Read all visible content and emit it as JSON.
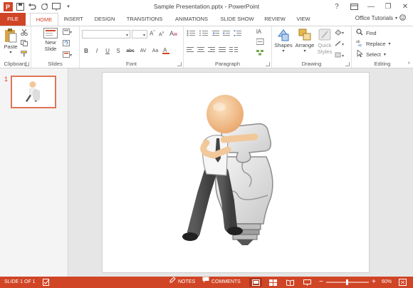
{
  "window": {
    "title": "Sample Presentation.pptx - PowerPoint",
    "help": "?",
    "minimize": "—",
    "restore": "❐",
    "close": "✕"
  },
  "tabs": [
    "FILE",
    "HOME",
    "INSERT",
    "DESIGN",
    "TRANSITIONS",
    "ANIMATIONS",
    "SLIDE SHOW",
    "REVIEW",
    "VIEW"
  ],
  "account": "Office Tutorials",
  "ribbon": {
    "clipboard": {
      "label": "Clipboard",
      "paste": "Paste"
    },
    "slides": {
      "label": "Slides",
      "new_slide": "New\nSlide"
    },
    "font": {
      "label": "Font",
      "format_buttons": [
        "B",
        "I",
        "U",
        "S",
        "abc",
        "AV",
        "Aa"
      ]
    },
    "paragraph": {
      "label": "Paragraph"
    },
    "drawing": {
      "label": "Drawing",
      "shapes": "Shapes",
      "arrange": "Arrange",
      "quick_styles": "Quick\nStyles"
    },
    "editing": {
      "label": "Editing",
      "find": "Find",
      "replace": "Replace",
      "select": "Select"
    }
  },
  "slides_panel": {
    "slide_number": "1"
  },
  "status": {
    "slide_info": "SLIDE 1 OF 1",
    "notes": "NOTES",
    "comments": "COMMENTS",
    "zoom": "60%",
    "zoom_minus": "−",
    "zoom_plus": "+"
  },
  "colors": {
    "accent": "#d04526",
    "panel": "#f4f4f4",
    "canvas": "#e6e6e6"
  }
}
